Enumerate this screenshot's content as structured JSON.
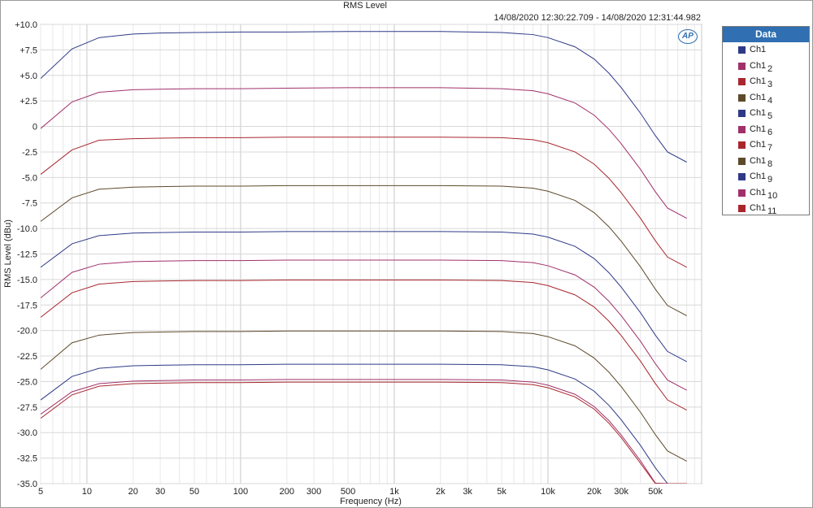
{
  "window": {
    "title": "RMS Level",
    "time_range": "14/08/2020 12:30:22.709 - 14/08/2020 12:31:44.982"
  },
  "logo_text": "AP",
  "legend": {
    "title": "Data",
    "items": [
      {
        "name": "Ch1",
        "sub": "",
        "color": "#2e3a87"
      },
      {
        "name": "Ch1",
        "sub": "2",
        "color": "#a0306a"
      },
      {
        "name": "Ch1",
        "sub": "3",
        "color": "#a8272e"
      },
      {
        "name": "Ch1",
        "sub": "4",
        "color": "#5e4a2a"
      },
      {
        "name": "Ch1",
        "sub": "5",
        "color": "#2e3a87"
      },
      {
        "name": "Ch1",
        "sub": "6",
        "color": "#a0306a"
      },
      {
        "name": "Ch1",
        "sub": "7",
        "color": "#a8272e"
      },
      {
        "name": "Ch1",
        "sub": "8",
        "color": "#5e4a2a"
      },
      {
        "name": "Ch1",
        "sub": "9",
        "color": "#2e3a87"
      },
      {
        "name": "Ch1",
        "sub": "10",
        "color": "#a0306a"
      },
      {
        "name": "Ch1",
        "sub": "11",
        "color": "#a8272e"
      }
    ]
  },
  "chart_data": {
    "type": "line",
    "title": "RMS Level",
    "xlabel": "Frequency (Hz)",
    "ylabel": "RMS Level (dBu)",
    "xscale": "log",
    "xlim": [
      5,
      100000
    ],
    "ylim": [
      -35,
      10
    ],
    "grid": true,
    "legend_position": "right",
    "x_ticks": [
      5,
      10,
      20,
      30,
      50,
      100,
      200,
      300,
      500,
      1000,
      2000,
      3000,
      5000,
      10000,
      20000,
      30000,
      50000
    ],
    "x_tick_labels": [
      "5",
      "10",
      "20",
      "30",
      "50",
      "100",
      "200",
      "300",
      "500",
      "1k",
      "2k",
      "3k",
      "5k",
      "10k",
      "20k",
      "30k",
      "50k"
    ],
    "y_ticks": [
      10,
      7.5,
      5,
      2.5,
      0,
      -2.5,
      -5,
      -7.5,
      -10,
      -12.5,
      -15,
      -17.5,
      -20,
      -22.5,
      -25,
      -27.5,
      -30,
      -32.5,
      -35
    ],
    "y_tick_labels": [
      "+10.0",
      "+7.5",
      "+5.0",
      "+2.5",
      "0",
      "-2.5",
      "-5.0",
      "-7.5",
      "-10.0",
      "-12.5",
      "-15.0",
      "-17.5",
      "-20.0",
      "-22.5",
      "-25.0",
      "-27.5",
      "-30.0",
      "-32.5",
      "-35.0"
    ],
    "x": [
      5,
      8,
      12,
      20,
      30,
      50,
      100,
      200,
      500,
      1000,
      2000,
      5000,
      8000,
      10000,
      15000,
      20000,
      25000,
      30000,
      40000,
      50000,
      60000,
      80000
    ],
    "series": [
      {
        "name": "Ch1",
        "color": "#2e3a87",
        "values": [
          4.7,
          7.6,
          8.7,
          9.05,
          9.15,
          9.2,
          9.25,
          9.25,
          9.3,
          9.3,
          9.3,
          9.2,
          9.0,
          8.7,
          7.8,
          6.6,
          5.2,
          3.8,
          1.3,
          -0.9,
          -2.5,
          -3.5
        ]
      },
      {
        "name": "Ch1 2",
        "color": "#a0306a",
        "values": [
          -0.2,
          2.4,
          3.35,
          3.6,
          3.65,
          3.7,
          3.7,
          3.75,
          3.8,
          3.8,
          3.8,
          3.7,
          3.5,
          3.2,
          2.3,
          1.1,
          -0.3,
          -1.7,
          -4.2,
          -6.4,
          -8.0,
          -9.0
        ]
      },
      {
        "name": "Ch1 3",
        "color": "#a8272e",
        "values": [
          -4.7,
          -2.3,
          -1.35,
          -1.2,
          -1.15,
          -1.1,
          -1.1,
          -1.05,
          -1.05,
          -1.05,
          -1.05,
          -1.1,
          -1.3,
          -1.6,
          -2.5,
          -3.7,
          -5.1,
          -6.5,
          -9.0,
          -11.2,
          -12.8,
          -13.8
        ]
      },
      {
        "name": "Ch1 4",
        "color": "#5e4a2a",
        "values": [
          -9.3,
          -7.0,
          -6.15,
          -5.95,
          -5.9,
          -5.85,
          -5.85,
          -5.8,
          -5.8,
          -5.8,
          -5.8,
          -5.85,
          -6.05,
          -6.35,
          -7.25,
          -8.45,
          -9.85,
          -11.25,
          -13.75,
          -15.95,
          -17.55,
          -18.55
        ]
      },
      {
        "name": "Ch1 5",
        "color": "#2e3a87",
        "values": [
          -13.8,
          -11.5,
          -10.7,
          -10.45,
          -10.4,
          -10.35,
          -10.35,
          -10.3,
          -10.3,
          -10.3,
          -10.3,
          -10.35,
          -10.55,
          -10.85,
          -11.75,
          -12.95,
          -14.35,
          -15.75,
          -18.25,
          -20.45,
          -22.05,
          -23.05
        ]
      },
      {
        "name": "Ch1 6",
        "color": "#a0306a",
        "values": [
          -16.8,
          -14.3,
          -13.5,
          -13.25,
          -13.2,
          -13.15,
          -13.15,
          -13.1,
          -13.1,
          -13.1,
          -13.1,
          -13.15,
          -13.35,
          -13.65,
          -14.55,
          -15.75,
          -17.15,
          -18.55,
          -21.05,
          -23.25,
          -24.85,
          -25.85
        ]
      },
      {
        "name": "Ch1 7",
        "color": "#a8272e",
        "values": [
          -18.7,
          -16.3,
          -15.45,
          -15.2,
          -15.15,
          -15.1,
          -15.1,
          -15.05,
          -15.05,
          -15.05,
          -15.05,
          -15.1,
          -15.3,
          -15.6,
          -16.5,
          -17.7,
          -19.1,
          -20.5,
          -23.0,
          -25.2,
          -26.8,
          -27.8
        ]
      },
      {
        "name": "Ch1 8",
        "color": "#5e4a2a",
        "values": [
          -23.8,
          -21.2,
          -20.45,
          -20.2,
          -20.15,
          -20.1,
          -20.1,
          -20.05,
          -20.05,
          -20.05,
          -20.05,
          -20.1,
          -20.3,
          -20.6,
          -21.5,
          -22.7,
          -24.1,
          -25.5,
          -28.0,
          -30.2,
          -31.8,
          -32.8
        ]
      },
      {
        "name": "Ch1 9",
        "color": "#2e3a87",
        "values": [
          -26.8,
          -24.5,
          -23.7,
          -23.45,
          -23.4,
          -23.35,
          -23.35,
          -23.3,
          -23.3,
          -23.3,
          -23.3,
          -23.35,
          -23.55,
          -23.85,
          -24.75,
          -25.95,
          -27.35,
          -28.75,
          -31.25,
          -33.45,
          -35.0,
          -35.0
        ]
      },
      {
        "name": "Ch1 10",
        "color": "#a0306a",
        "values": [
          -28.2,
          -26.0,
          -25.2,
          -24.95,
          -24.9,
          -24.85,
          -24.85,
          -24.8,
          -24.8,
          -24.8,
          -24.8,
          -24.85,
          -25.05,
          -25.35,
          -26.25,
          -27.45,
          -28.85,
          -30.25,
          -32.75,
          -34.95,
          -35.0,
          -35.0
        ]
      },
      {
        "name": "Ch1 11",
        "color": "#a8272e",
        "values": [
          -28.6,
          -26.3,
          -25.45,
          -25.2,
          -25.15,
          -25.1,
          -25.1,
          -25.05,
          -25.05,
          -25.05,
          -25.05,
          -25.1,
          -25.3,
          -25.6,
          -26.5,
          -27.7,
          -29.1,
          -30.5,
          -33.0,
          -35.0,
          -35.0,
          -35.0
        ]
      }
    ]
  }
}
